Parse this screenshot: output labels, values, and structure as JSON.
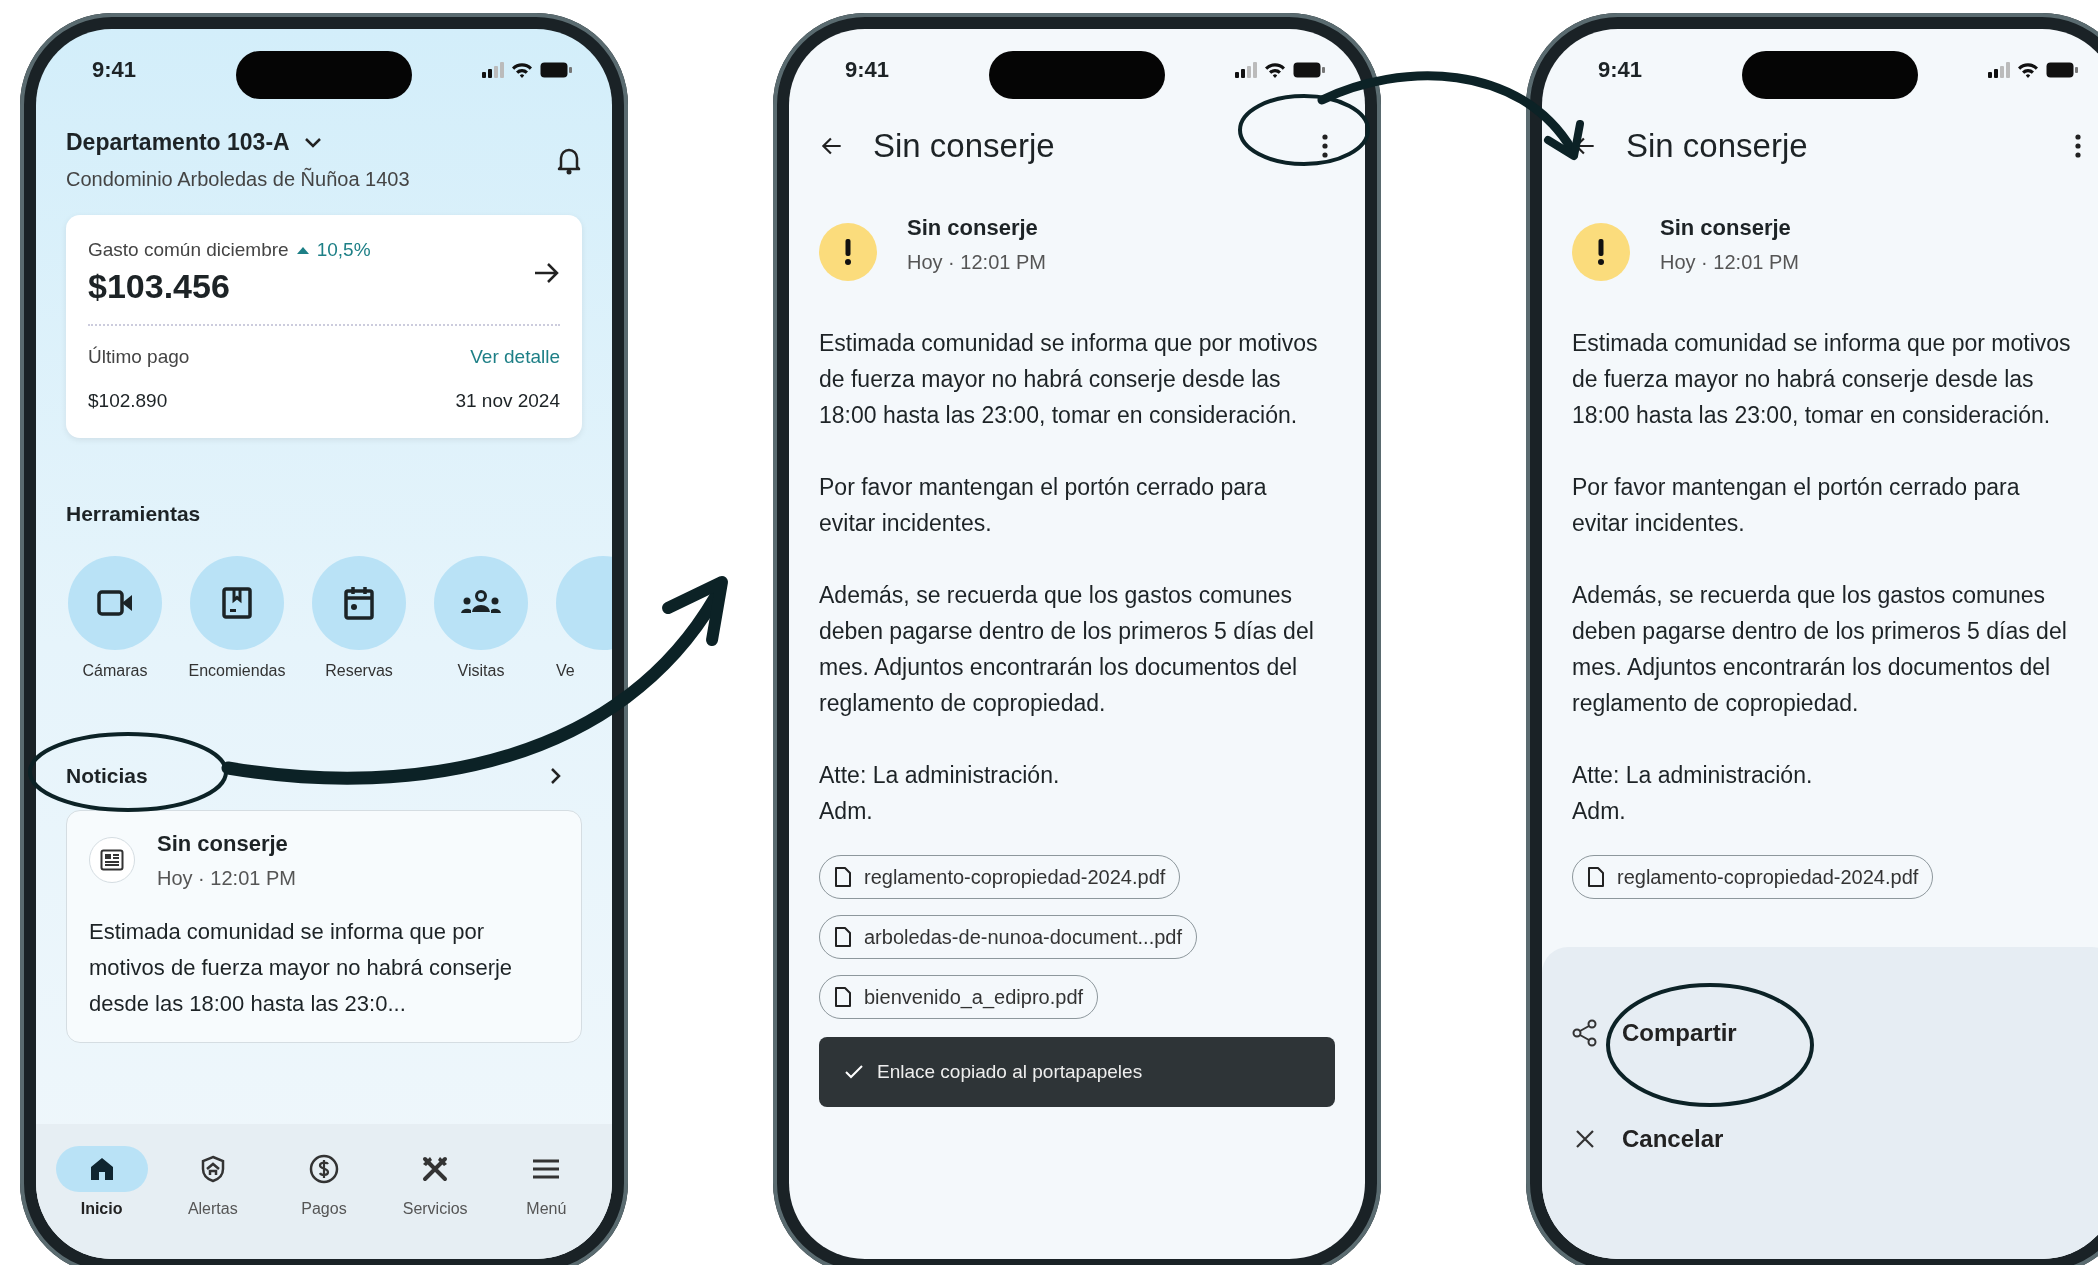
{
  "home_screen": {
    "status_bar": {
      "time": "9:41"
    },
    "unit": "Departamento 103-A",
    "condominium": "Condominio Arboledas de Ñuñoa 1403",
    "expense_card": {
      "label": "Gasto común diciembre",
      "change": "10,5%",
      "amount": "$103.456",
      "last_payment_label": "Último pago",
      "detail_link": "Ver detalle",
      "last_payment_amount": "$102.890",
      "last_payment_date": "31 nov 2024"
    },
    "tools_title": "Herramientas",
    "tools": [
      {
        "kind": "camera",
        "label": "Cámaras"
      },
      {
        "kind": "package",
        "label": "Encomiendas"
      },
      {
        "kind": "calendar",
        "label": "Reservas"
      },
      {
        "kind": "people",
        "label": "Visitas"
      },
      {
        "kind": "unknown",
        "label": "Ve"
      }
    ],
    "news_title": "Noticias",
    "news": [
      {
        "title": "Sin conserje",
        "time": "Hoy · 12:01 PM",
        "excerpt": "Estimada comunidad se informa que por motivos de fuerza mayor no habrá conserje desde las 18:00 hasta las 23:0..."
      }
    ],
    "nav": [
      {
        "kind": "home",
        "label": "Inicio",
        "selected": true
      },
      {
        "kind": "shield",
        "label": "Alertas",
        "selected": false
      },
      {
        "kind": "dollar",
        "label": "Pagos",
        "selected": false
      },
      {
        "kind": "tools",
        "label": "Servicios",
        "selected": false
      },
      {
        "kind": "menu",
        "label": "Menú",
        "selected": false
      }
    ]
  },
  "notice_screen": {
    "status_bar": {
      "time": "9:41"
    },
    "title": "Sin conserje",
    "notice": {
      "title": "Sin conserje",
      "time": "Hoy · 12:01 PM",
      "paragraphs": [
        "Estimada comunidad se informa que por motivos de fuerza mayor no habrá conserje desde las 18:00 hasta las 23:00, tomar en consideración.",
        "Por favor mantengan el portón cerrado para evitar incidentes.",
        "Además, se recuerda que los gastos comunes deben pagarse dentro de los primeros 5 días del mes. Adjuntos encontrarán los documentos del reglamento de copropiedad.",
        "Atte: La administración.\nAdm."
      ]
    },
    "attachments": [
      "reglamento-copropiedad-2024.pdf",
      "arboledas-de-nunoa-document...pdf",
      "bienvenido_a_edipro.pdf"
    ],
    "snackbar": "Enlace copiado al portapapeles"
  },
  "share_screen": {
    "status_bar": {
      "time": "9:41"
    },
    "title": "Sin conserje",
    "notice": {
      "title": "Sin conserje",
      "time": "Hoy · 12:01 PM",
      "paragraphs": [
        "Estimada comunidad se informa que por motivos de fuerza mayor no habrá conserje desde las 18:00 hasta las 23:00, tomar en consideración.",
        "Por favor mantengan el portón cerrado para evitar incidentes.",
        "Además, se recuerda que los gastos comunes deben pagarse dentro de los primeros 5 días del mes. Adjuntos encontrarán los documentos del reglamento de copropiedad.",
        "Atte: La administración.\nAdm."
      ]
    },
    "attachments": [
      "reglamento-copropiedad-2024.pdf"
    ],
    "sheet_actions": [
      {
        "kind": "share",
        "label": "Compartir"
      },
      {
        "kind": "cancel",
        "label": "Cancelar"
      }
    ]
  }
}
